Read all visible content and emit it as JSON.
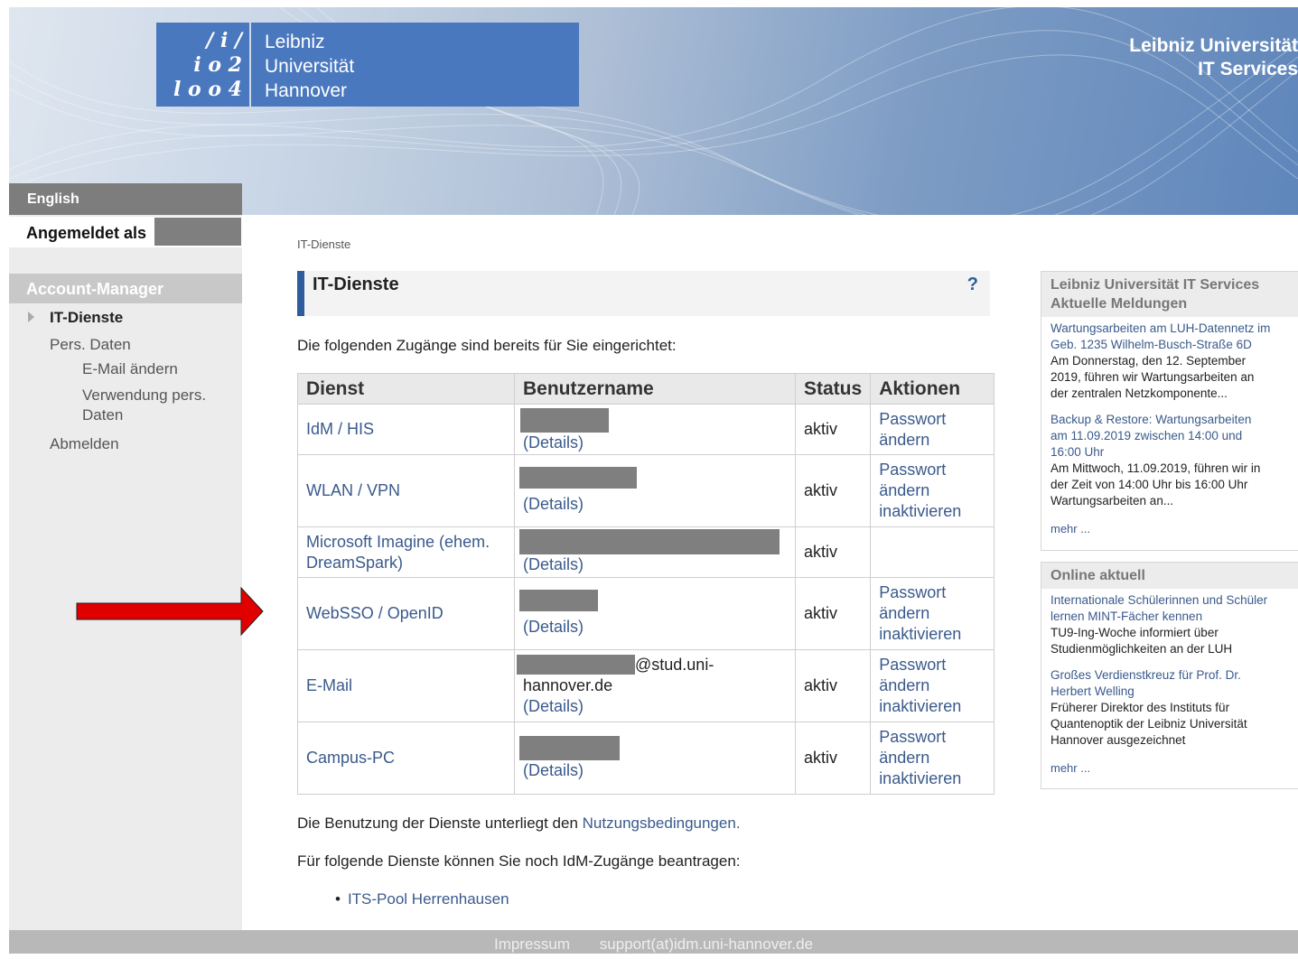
{
  "header": {
    "logo_digits": [
      "/ i /",
      "i o 2",
      "l o o 4"
    ],
    "logo_lines": [
      "Leibniz",
      "Universität",
      "Hannover"
    ],
    "title_lines": [
      "Leibniz Universität",
      "IT Services"
    ]
  },
  "sidebar": {
    "language_link": "English",
    "logged_in_label": "Angemeldet als",
    "section_title": "Account-Manager",
    "items": [
      {
        "label": "IT-Dienste",
        "active": true
      },
      {
        "label": "Pers. Daten"
      },
      {
        "label": "E-Mail ändern"
      },
      {
        "label": "Verwendung pers."
      },
      {
        "label": "Daten"
      },
      {
        "label": "Abmelden"
      }
    ]
  },
  "main": {
    "breadcrumb": "IT-Dienste",
    "title": "IT-Dienste",
    "help": "?",
    "intro": "Die folgenden Zugänge sind bereits für Sie eingerichtet:",
    "table": {
      "headers": [
        "Dienst",
        "Benutzername",
        "Status",
        "Aktionen"
      ],
      "rows": [
        {
          "service": "IdM / HIS",
          "details": "(Details)",
          "status": "aktiv",
          "actions": [
            "Passwort",
            "ändern"
          ]
        },
        {
          "service": "WLAN / VPN",
          "details": "(Details)",
          "status": "aktiv",
          "actions": [
            "Passwort",
            "ändern",
            "inaktivieren"
          ]
        },
        {
          "service_lines": [
            "Microsoft Imagine (ehem.",
            "DreamSpark)"
          ],
          "details": "(Details)",
          "status": "aktiv",
          "actions": []
        },
        {
          "service": "WebSSO / OpenID",
          "details": "(Details)",
          "status": "aktiv",
          "actions": [
            "Passwort",
            "ändern",
            "inaktivieren"
          ]
        },
        {
          "service": "E-Mail",
          "email_suffix_1": "@stud.uni-",
          "email_suffix_2": "hannover.de",
          "details": "(Details)",
          "status": "aktiv",
          "actions": [
            "Passwort",
            "ändern",
            "inaktivieren"
          ]
        },
        {
          "service": "Campus-PC",
          "details": "(Details)",
          "status": "aktiv",
          "actions": [
            "Passwort",
            "ändern",
            "inaktivieren"
          ]
        }
      ]
    },
    "terms_prefix": "Die Benutzung der Dienste unterliegt den ",
    "terms_link": "Nutzungsbedingungen",
    "terms_suffix": ".",
    "request_text": "Für folgende Dienste können Sie noch IdM-Zugänge beantragen:",
    "request_items": [
      "ITS-Pool Herrenhausen"
    ]
  },
  "news": {
    "box1": {
      "title_lines": [
        "Leibniz Universität IT Services",
        "Aktuelle Meldungen"
      ],
      "items": [
        {
          "link_lines": [
            "Wartungsarbeiten am LUH-Datennetz im",
            "Geb. 1235 Wilhelm-Busch-Straße 6D"
          ],
          "text_lines": [
            "Am Donnerstag, den 12. September",
            "2019, führen wir Wartungsarbeiten an",
            "der zentralen Netzkomponente..."
          ]
        },
        {
          "link_lines": [
            "Backup & Restore: Wartungsarbeiten",
            "am 11.09.2019 zwischen 14:00 und",
            "16:00 Uhr"
          ],
          "text_lines": [
            "Am Mittwoch, 11.09.2019, führen wir in",
            "der Zeit von 14:00 Uhr bis 16:00 Uhr",
            "Wartungsarbeiten an..."
          ]
        }
      ],
      "more": "mehr ..."
    },
    "box2": {
      "title": "Online aktuell",
      "items": [
        {
          "link_lines": [
            "Internationale Schülerinnen und Schüler",
            "lernen MINT-Fächer kennen"
          ],
          "text_lines": [
            "TU9-Ing-Woche informiert über",
            "Studienmöglichkeiten an der LUH"
          ]
        },
        {
          "link_lines": [
            "Großes Verdienstkreuz für Prof. Dr.",
            "Herbert Welling"
          ],
          "text_lines": [
            "Früherer Direktor des Instituts für",
            "Quantenoptik der Leibniz Universität",
            "Hannover ausgezeichnet"
          ]
        }
      ],
      "more": "mehr ..."
    }
  },
  "footer": {
    "impressum": "Impressum",
    "support": "support(at)idm.uni-hannover.de"
  },
  "colors": {
    "accent": "#2d5d9c",
    "logo_blue": "#4a78bf",
    "arrow_red": "#e00000"
  }
}
